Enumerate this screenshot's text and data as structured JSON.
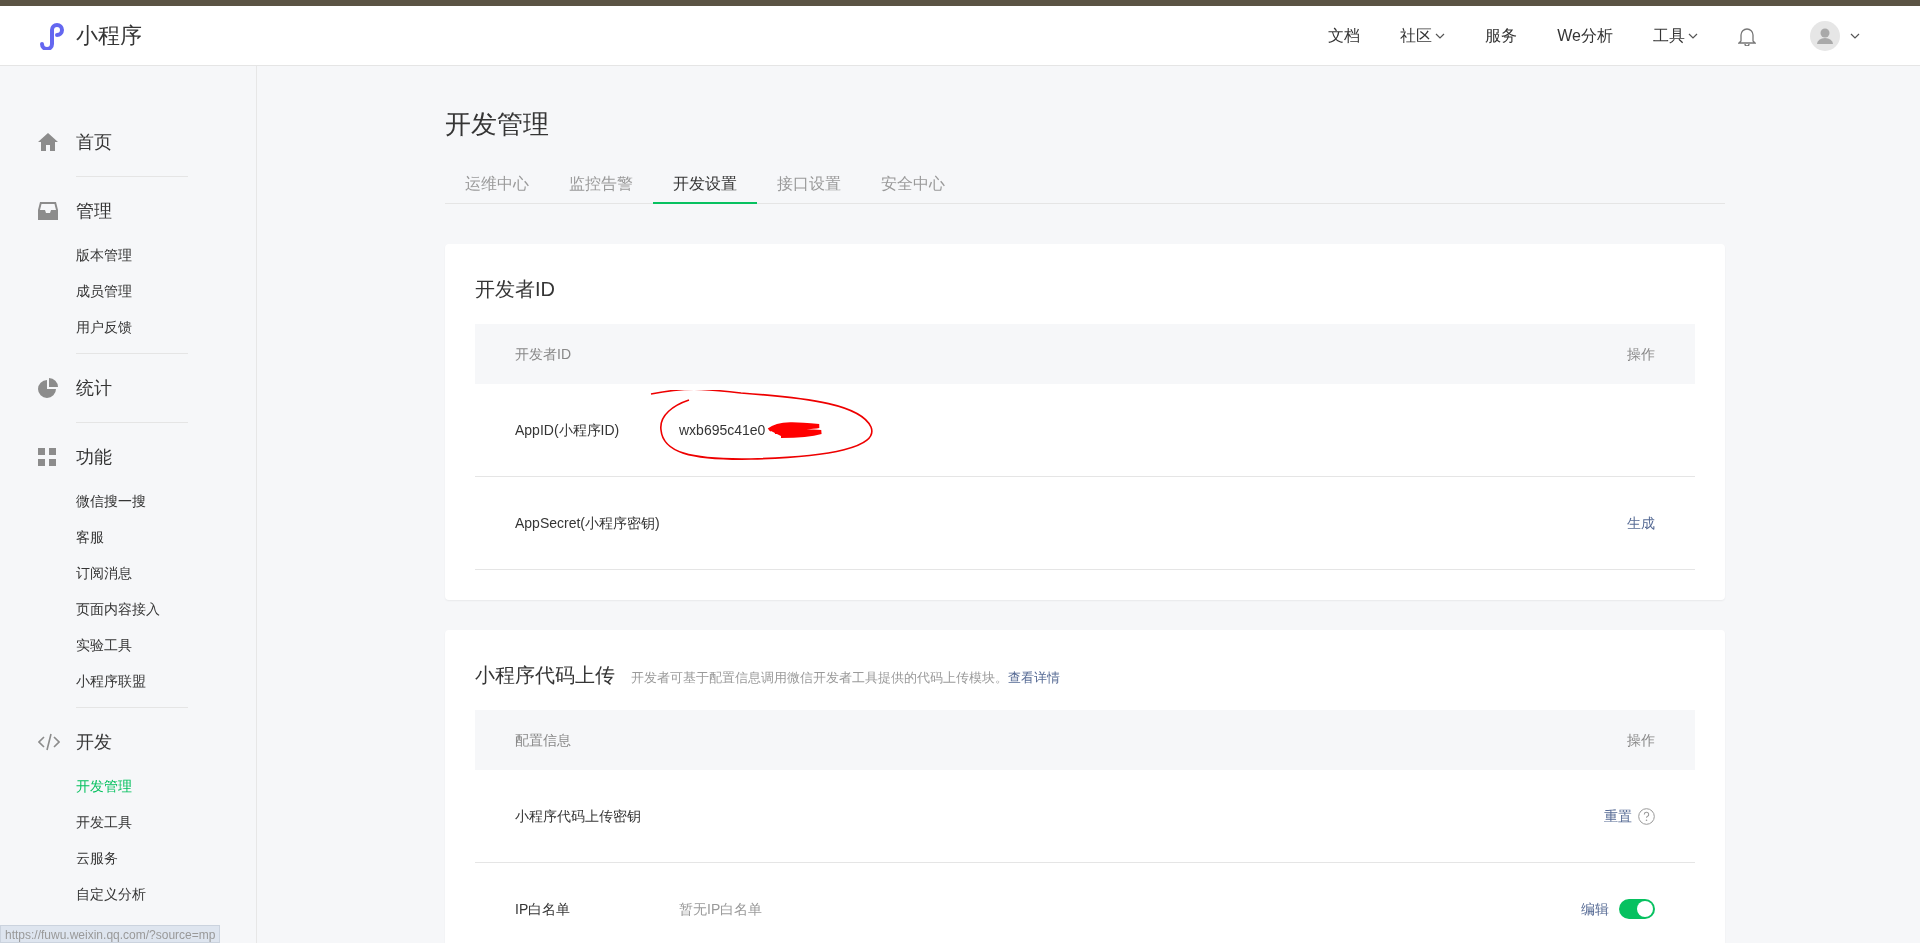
{
  "header": {
    "logo_text": "小程序",
    "nav": [
      {
        "label": "文档",
        "dropdown": false
      },
      {
        "label": "社区",
        "dropdown": true
      },
      {
        "label": "服务",
        "dropdown": false
      },
      {
        "label": "We分析",
        "dropdown": false
      },
      {
        "label": "工具",
        "dropdown": true
      }
    ]
  },
  "sidebar": {
    "groups": [
      {
        "label": "首页"
      },
      {
        "label": "管理",
        "children": [
          {
            "label": "版本管理",
            "selected": false
          },
          {
            "label": "成员管理",
            "selected": false
          },
          {
            "label": "用户反馈",
            "selected": false
          }
        ]
      },
      {
        "label": "统计"
      },
      {
        "label": "功能",
        "children": [
          {
            "label": "微信搜一搜",
            "selected": false
          },
          {
            "label": "客服",
            "selected": false
          },
          {
            "label": "订阅消息",
            "selected": false
          },
          {
            "label": "页面内容接入",
            "selected": false
          },
          {
            "label": "实验工具",
            "selected": false
          },
          {
            "label": "小程序联盟",
            "selected": false
          }
        ]
      },
      {
        "label": "开发",
        "children": [
          {
            "label": "开发管理",
            "selected": true
          },
          {
            "label": "开发工具",
            "selected": false
          },
          {
            "label": "云服务",
            "selected": false
          },
          {
            "label": "自定义分析",
            "selected": false
          }
        ]
      }
    ]
  },
  "page": {
    "title": "开发管理",
    "tabs": [
      {
        "label": "运维中心",
        "selected": false
      },
      {
        "label": "监控告警",
        "selected": false
      },
      {
        "label": "开发设置",
        "selected": true
      },
      {
        "label": "接口设置",
        "selected": false
      },
      {
        "label": "安全中心",
        "selected": false
      }
    ]
  },
  "developer_id_card": {
    "title": "开发者ID",
    "columns": [
      "开发者ID",
      "操作"
    ],
    "rows": [
      {
        "label": "AppID(小程序ID)",
        "value": "wxb695c41e0"
      },
      {
        "label": "AppSecret(小程序密钥)",
        "action": "生成"
      }
    ]
  },
  "upload_card": {
    "title": "小程序代码上传",
    "description": "开发者可基于配置信息调用微信开发者工具提供的代码上传模块。",
    "link": "查看详情",
    "columns": [
      "配置信息",
      "操作"
    ],
    "rows": [
      {
        "kind": "key",
        "label": "小程序代码上传密钥",
        "action": "重置"
      },
      {
        "kind": "toggle",
        "label": "IP白名单",
        "value": "暂无IP白名单",
        "action": "编辑",
        "on": true
      }
    ]
  },
  "status_url": "https://fuwu.weixin.qq.com/?source=mp"
}
